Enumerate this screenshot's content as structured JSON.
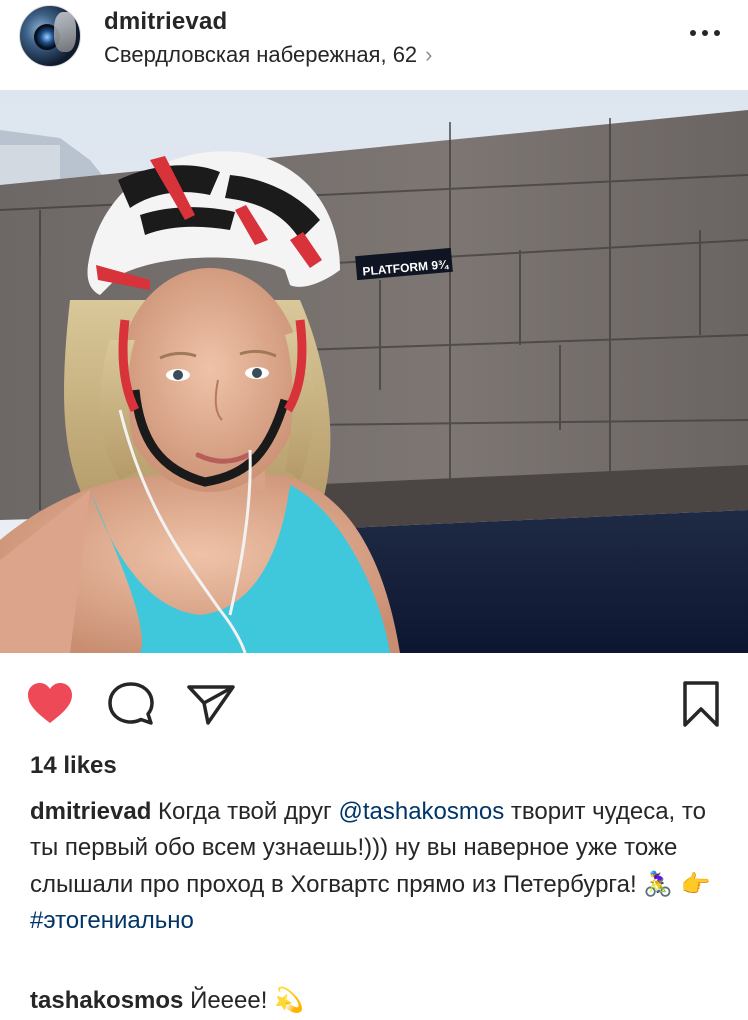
{
  "header": {
    "username": "dmitrievad",
    "location": "Свердловская набережная, 62",
    "location_chevron": "›",
    "more_icon": "more-dots-icon"
  },
  "photo": {
    "sign_text": "PLATFORM 9¾",
    "colors": {
      "sky": "#e3e9f1",
      "wall": "#6f6a66",
      "top": "#3fc7dc",
      "helmet": "#f4f4f4",
      "stripe": "#d8323a"
    }
  },
  "actions": {
    "like_icon": "heart-filled-icon",
    "comment_icon": "comment-bubble-icon",
    "share_icon": "paper-plane-icon",
    "save_icon": "bookmark-icon",
    "like_color": "#ed4956"
  },
  "likes": "14 likes",
  "caption": {
    "username": "dmitrievad",
    "text_before": "Когда твой друг ",
    "mention": "@tashakosmos",
    "text_after": " творит чудеса, то ты первый обо всем узнаешь!))) ну вы наверное уже тоже слышали про проход в Хогвартс прямо из Петербурга! ",
    "emojis": "🚴‍♀️ 👉",
    "hashtag": "#этогениально"
  },
  "comment": {
    "username": "tashakosmos",
    "text": " Йееее! ",
    "emoji": "💫"
  }
}
